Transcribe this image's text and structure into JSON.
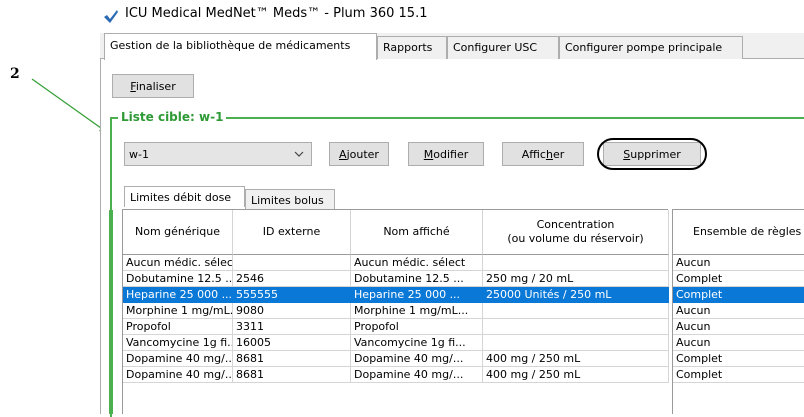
{
  "callout": {
    "number": "2"
  },
  "window": {
    "title": "ICU Medical MedNet™ Meds™ - Plum 360 15.1"
  },
  "tabs": [
    {
      "label": "Gestion de la bibliothèque de médicaments"
    },
    {
      "label": "Rapports"
    },
    {
      "label": "Configurer USC"
    },
    {
      "label": "Configurer pompe principale"
    }
  ],
  "toolbar": {
    "finalize_label": "Finaliser"
  },
  "target_list": {
    "title": "Liste cible: w-1",
    "selected": "w-1",
    "add_label": "Ajouter",
    "modify_label": "Modifier",
    "show_label": "Afficher",
    "delete_label": "Supprimer"
  },
  "inner_tabs": [
    {
      "label": "Limites débit dose"
    },
    {
      "label": "Limites bolus"
    }
  ],
  "table": {
    "headers": {
      "generic": "Nom générique",
      "ext_id": "ID externe",
      "display": "Nom affiché",
      "conc_line1": "Concentration",
      "conc_line2": "(ou volume du réservoir)",
      "ruleset": "Ensemble de règles"
    },
    "rows": [
      {
        "generic": "Aucun médic. sélect",
        "ext_id": "",
        "display": "Aucun médic. sélect",
        "conc": "",
        "ruleset": "Aucun"
      },
      {
        "generic": "Dobutamine 12.5 ...",
        "ext_id": "2546",
        "display": "Dobutamine 12.5 ...",
        "conc": "250 mg / 20 mL",
        "ruleset": "Complet"
      },
      {
        "generic": "Heparine 25 000 ...",
        "ext_id": "555555",
        "display": "Heparine 25 000 ...",
        "conc": "25000 Unités / 250 mL",
        "ruleset": "Complet"
      },
      {
        "generic": "Morphine 1 mg/mL...",
        "ext_id": "9080",
        "display": "Morphine 1 mg/mL...",
        "conc": "",
        "ruleset": "Aucun"
      },
      {
        "generic": "Propofol",
        "ext_id": "3311",
        "display": "Propofol",
        "conc": "",
        "ruleset": "Aucun"
      },
      {
        "generic": "Vancomycine 1g fi...",
        "ext_id": "16005",
        "display": "Vancomycine 1g fi...",
        "conc": "",
        "ruleset": "Aucun"
      },
      {
        "generic": "Dopamine 40 mg/...",
        "ext_id": "8681",
        "display": "Dopamine 40 mg/...",
        "conc": "400 mg / 250 mL",
        "ruleset": "Complet"
      },
      {
        "generic": "Dopamine 40 mg/...",
        "ext_id": "8681",
        "display": "Dopamine 40 mg/...",
        "conc": "400 mg / 250 mL",
        "ruleset": "Complet"
      }
    ]
  },
  "colors": {
    "accent_green": "#4caf50",
    "selection": "#0a78d7"
  }
}
